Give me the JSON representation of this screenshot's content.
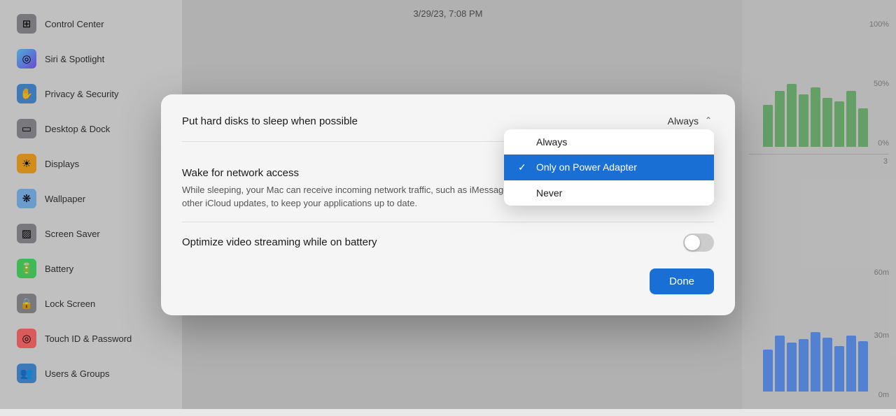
{
  "time": "3/29/23, 7:08 PM",
  "sidebar": {
    "items": [
      {
        "id": "control-center",
        "label": "Control Center",
        "icon_char": "⊞",
        "icon_class": "icon-control"
      },
      {
        "id": "siri-spotlight",
        "label": "Siri & Spotlight",
        "icon_char": "◎",
        "icon_class": "icon-siri"
      },
      {
        "id": "privacy-security",
        "label": "Privacy & Security",
        "icon_char": "✋",
        "icon_class": "icon-privacy"
      },
      {
        "id": "desktop",
        "label": "Desktop & Dock",
        "icon_char": "▭",
        "icon_class": "icon-desktop"
      },
      {
        "id": "displays",
        "label": "Displays",
        "icon_char": "☀",
        "icon_class": "icon-displays"
      },
      {
        "id": "wallpaper",
        "label": "Wallpaper",
        "icon_char": "❋",
        "icon_class": "icon-wallpaper"
      },
      {
        "id": "screensaver",
        "label": "Screen Saver",
        "icon_char": "▨",
        "icon_class": "icon-screensaver"
      },
      {
        "id": "battery",
        "label": "Battery",
        "icon_char": "🔋",
        "icon_class": "icon-battery"
      },
      {
        "id": "lock-screen",
        "label": "Lock Screen",
        "icon_char": "🔒",
        "icon_class": "icon-lock"
      },
      {
        "id": "touchid",
        "label": "Touch ID & Password",
        "icon_char": "◎",
        "icon_class": "icon-touchid"
      },
      {
        "id": "users-groups",
        "label": "Users & Groups",
        "icon_char": "👥",
        "icon_class": "icon-users"
      }
    ]
  },
  "dialog": {
    "hard_disk_label": "Put hard disks to sleep when possible",
    "hard_disk_value": "Always",
    "wake_title": "Wake for network access",
    "wake_description": "While sleeping, your Mac can receive incoming network traffic, such as iMessages and other iCloud updates, to keep your applications up to date.",
    "optimize_label": "Optimize video streaming while on battery",
    "done_button": "Done",
    "dropdown": {
      "options": [
        {
          "id": "always",
          "label": "Always",
          "selected": false
        },
        {
          "id": "only-power",
          "label": "Only on Power Adapter",
          "selected": true
        },
        {
          "id": "never",
          "label": "Never",
          "selected": false
        }
      ]
    }
  },
  "chart": {
    "top_labels": [
      "100%",
      "50%",
      "0%"
    ],
    "bottom_labels": [
      "60m",
      "30m",
      "0m"
    ],
    "top_bars": [
      60,
      80,
      90,
      75,
      85,
      70,
      65,
      80,
      55
    ],
    "bottom_bars": [
      120,
      160,
      140,
      150,
      170,
      155,
      130,
      160,
      145
    ]
  }
}
